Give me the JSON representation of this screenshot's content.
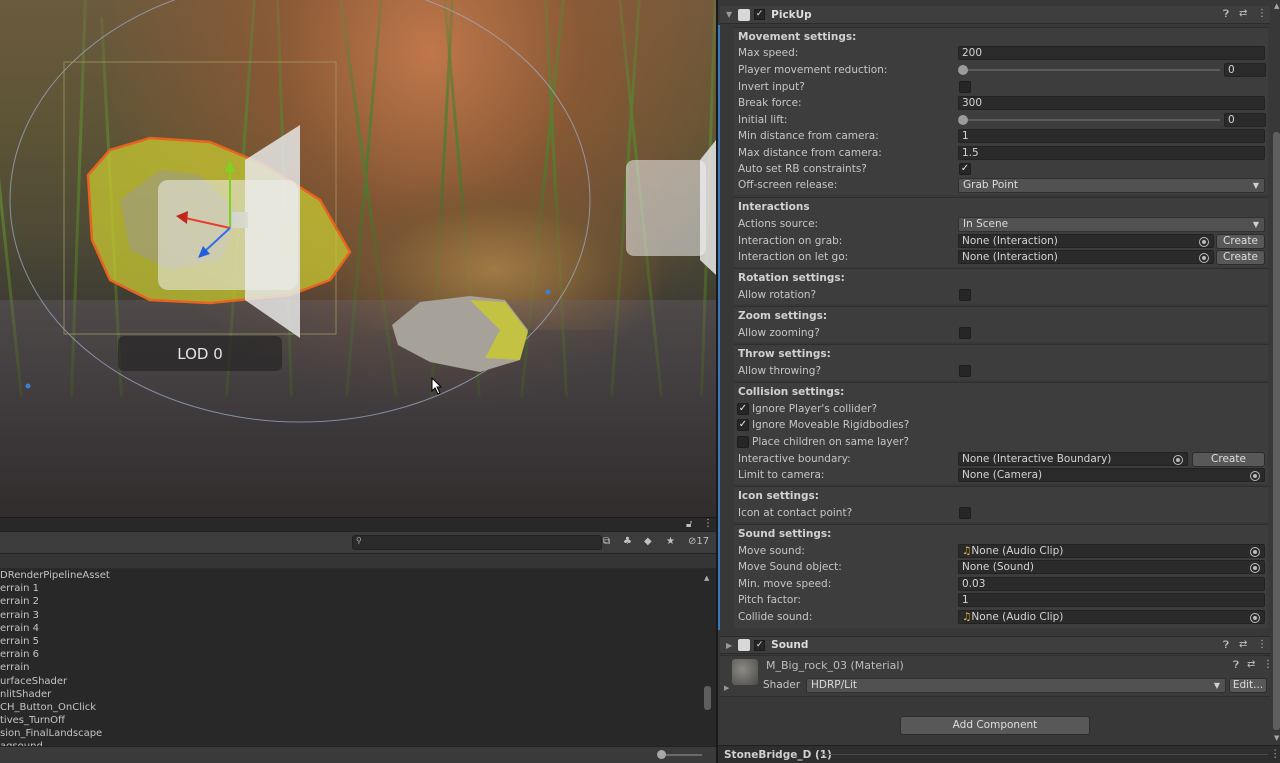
{
  "scene": {
    "lod_label": "LOD 0"
  },
  "project": {
    "search_placeholder": "",
    "hidden_count": "17",
    "items": [
      "DRenderPipelineAsset",
      "errain 1",
      "errain 2",
      "errain 3",
      "errain 4",
      "errain 5",
      "errain 6",
      "errain",
      "urfaceShader",
      "nlitShader",
      "CH_Button_OnClick",
      "tives_TurnOff",
      "sion_FinalLandscape",
      "agsound"
    ]
  },
  "inspector": {
    "pickup": {
      "title": "PickUp",
      "movement": {
        "title": "Movement settings:",
        "max_speed_label": "Max speed:",
        "max_speed": "200",
        "player_reduction_label": "Player movement reduction:",
        "player_reduction": "0",
        "invert_label": "Invert input?",
        "break_label": "Break force:",
        "break_force": "300",
        "lift_label": "Initial lift:",
        "lift": "0",
        "min_dist_label": "Min distance from camera:",
        "min_dist": "1",
        "max_dist_label": "Max distance from camera:",
        "max_dist": "1.5",
        "auto_rb_label": "Auto set RB constraints?",
        "offscreen_label": "Off-screen release:",
        "offscreen": "Grab Point"
      },
      "interactions": {
        "title": "Interactions",
        "source_label": "Actions source:",
        "source": "In Scene",
        "grab_label": "Interaction on grab:",
        "grab_value": "None (Interaction)",
        "letgo_label": "Interaction on let go:",
        "letgo_value": "None (Interaction)",
        "create": "Create"
      },
      "rotation": {
        "title": "Rotation settings:",
        "allow_label": "Allow rotation?"
      },
      "zoom": {
        "title": "Zoom settings:",
        "allow_label": "Allow zooming?"
      },
      "throw": {
        "title": "Throw settings:",
        "allow_label": "Allow throwing?"
      },
      "collision": {
        "title": "Collision settings:",
        "ignore_player": "Ignore Player's collider?",
        "ignore_rb": "Ignore Moveable Rigidbodies?",
        "place_children": "Place children on same layer?",
        "boundary_label": "Interactive boundary:",
        "boundary_value": "None (Interactive Boundary)",
        "limit_label": "Limit to camera:",
        "limit_value": "None (Camera)",
        "create": "Create"
      },
      "icon": {
        "title": "Icon settings:",
        "contact_label": "Icon at contact point?"
      },
      "sound": {
        "title": "Sound settings:",
        "move_sound_label": "Move sound:",
        "move_sound": "None (Audio Clip)",
        "move_obj_label": "Move Sound object:",
        "move_obj": "None (Sound)",
        "min_speed_label": "Min. move speed:",
        "min_speed": "0.03",
        "pitch_label": "Pitch factor:",
        "pitch": "1",
        "collide_label": "Collide sound:",
        "collide": "None (Audio Clip)"
      }
    },
    "sound_component": {
      "title": "Sound"
    },
    "material": {
      "name": "M_Big_rock_03 (Material)",
      "shader_label": "Shader",
      "shader": "HDRP/Lit",
      "edit": "Edit..."
    },
    "add_component": "Add Component",
    "footer": "StoneBridge_D (1)"
  },
  "colors": {
    "accent_blue": "#3a79bb",
    "selection_orange": "#e8641e",
    "lod_yellow": "#c8c832"
  }
}
